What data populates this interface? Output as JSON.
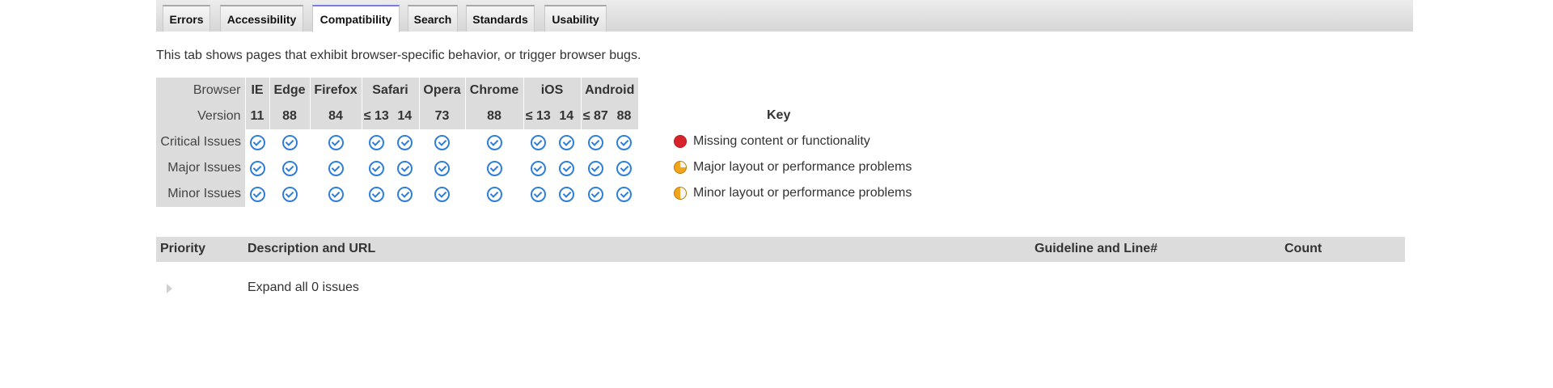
{
  "tabs": [
    {
      "label": "Errors",
      "active": false
    },
    {
      "label": "Accessibility",
      "active": false
    },
    {
      "label": "Compatibility",
      "active": true
    },
    {
      "label": "Search",
      "active": false
    },
    {
      "label": "Standards",
      "active": false
    },
    {
      "label": "Usability",
      "active": false
    }
  ],
  "intro_text": "This tab shows pages that exhibit browser-specific behavior, or trigger browser bugs.",
  "matrix": {
    "browser_label": "Browser",
    "version_label": "Version",
    "browsers": [
      {
        "name": "IE",
        "versions": [
          "11"
        ]
      },
      {
        "name": "Edge",
        "versions": [
          "88"
        ]
      },
      {
        "name": "Firefox",
        "versions": [
          "84"
        ]
      },
      {
        "name": "Safari",
        "versions": [
          "≤ 13",
          "14"
        ]
      },
      {
        "name": "Opera",
        "versions": [
          "73"
        ]
      },
      {
        "name": "Chrome",
        "versions": [
          "88"
        ]
      },
      {
        "name": "iOS",
        "versions": [
          "≤ 13",
          "14"
        ]
      },
      {
        "name": "Android",
        "versions": [
          "≤ 87",
          "88"
        ]
      }
    ],
    "rows": [
      {
        "label": "Critical Issues",
        "status": "ok"
      },
      {
        "label": "Major Issues",
        "status": "ok"
      },
      {
        "label": "Minor Issues",
        "status": "ok"
      }
    ],
    "status_icon": "check-circle-icon"
  },
  "key": {
    "title": "Key",
    "items": [
      {
        "label": "Missing content or functionality",
        "icon": "red-circle-icon",
        "color": "#d8232a"
      },
      {
        "label": "Major layout or performance problems",
        "icon": "three-quarter-pie-icon",
        "color": "#f0a51d"
      },
      {
        "label": "Minor layout or performance problems",
        "icon": "half-circle-icon",
        "color": "#f0a51d"
      }
    ]
  },
  "issues_table": {
    "headers": {
      "priority": "Priority",
      "description": "Description and URL",
      "guideline": "Guideline and Line#",
      "count": "Count"
    },
    "expand_text": "Expand all 0 issues"
  }
}
